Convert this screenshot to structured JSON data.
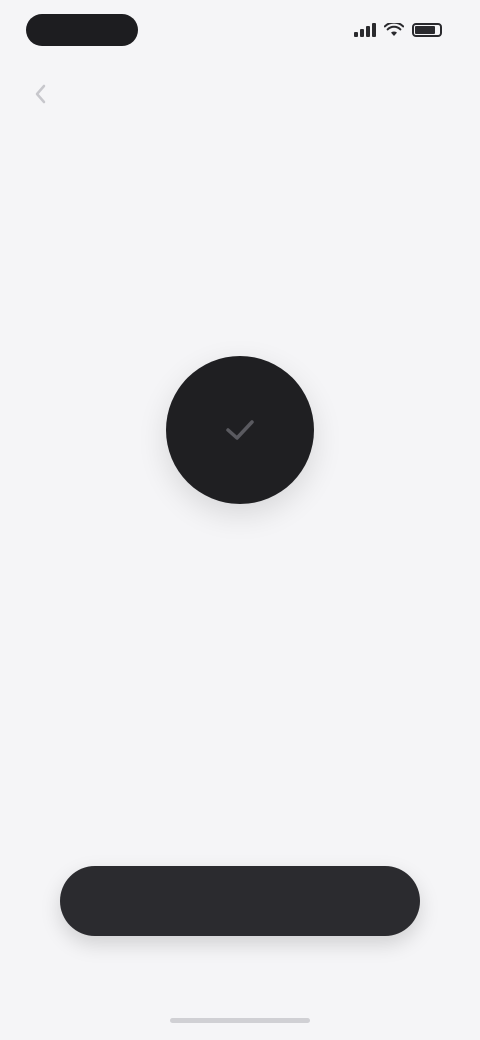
{
  "status_bar": {
    "time": "",
    "signal_icon": "signal-bars-icon",
    "wifi_icon": "wifi-icon",
    "battery_icon": "battery-icon",
    "battery_level": 0.85
  },
  "navigation": {
    "back_icon": "chevron-left-icon"
  },
  "success": {
    "icon": "checkmark-icon",
    "title": "",
    "subtitle": ""
  },
  "primary_action": {
    "label": ""
  },
  "colors": {
    "background": "#f5f5f7",
    "circle": "#1f1f22",
    "button": "#2b2b2f",
    "title": "#1f1f22",
    "subtitle": "#8e8e93"
  }
}
